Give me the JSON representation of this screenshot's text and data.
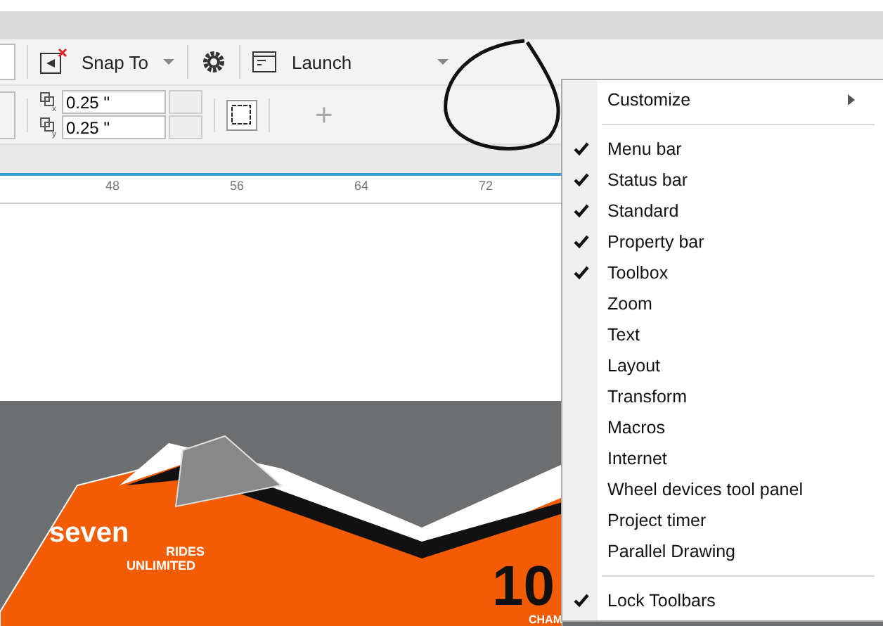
{
  "toolbar": {
    "snap_label": "Snap To",
    "launch_label": "Launch"
  },
  "property_bar": {
    "fields": [
      {
        "axis": "x",
        "value": "0.25 \""
      },
      {
        "axis": "y",
        "value": "0.25 \""
      }
    ],
    "add_label": "+"
  },
  "ruler": {
    "ticks": [
      "48",
      "56",
      "64",
      "72"
    ]
  },
  "artwork": {
    "texts": [
      "seven",
      "RIDES",
      "UNLIMITED",
      "10",
      "CHAM"
    ]
  },
  "menu": {
    "items": [
      {
        "kind": "submenu",
        "label": "Customize"
      },
      {
        "kind": "separator"
      },
      {
        "kind": "toggle",
        "label": "Menu bar",
        "checked": true
      },
      {
        "kind": "toggle",
        "label": "Status bar",
        "checked": true
      },
      {
        "kind": "toggle",
        "label": "Standard",
        "checked": true
      },
      {
        "kind": "toggle",
        "label": "Property bar",
        "checked": true
      },
      {
        "kind": "toggle",
        "label": "Toolbox",
        "checked": true
      },
      {
        "kind": "toggle",
        "label": "Zoom",
        "checked": false
      },
      {
        "kind": "toggle",
        "label": "Text",
        "checked": false
      },
      {
        "kind": "toggle",
        "label": "Layout",
        "checked": false
      },
      {
        "kind": "toggle",
        "label": "Transform",
        "checked": false
      },
      {
        "kind": "toggle",
        "label": "Macros",
        "checked": false
      },
      {
        "kind": "toggle",
        "label": "Internet",
        "checked": false
      },
      {
        "kind": "toggle",
        "label": "Wheel devices tool panel",
        "checked": false
      },
      {
        "kind": "toggle",
        "label": "Project timer",
        "checked": false
      },
      {
        "kind": "toggle",
        "label": "Parallel Drawing",
        "checked": false
      },
      {
        "kind": "separator"
      },
      {
        "kind": "toggle",
        "label": "Lock Toolbars",
        "checked": true
      }
    ]
  }
}
